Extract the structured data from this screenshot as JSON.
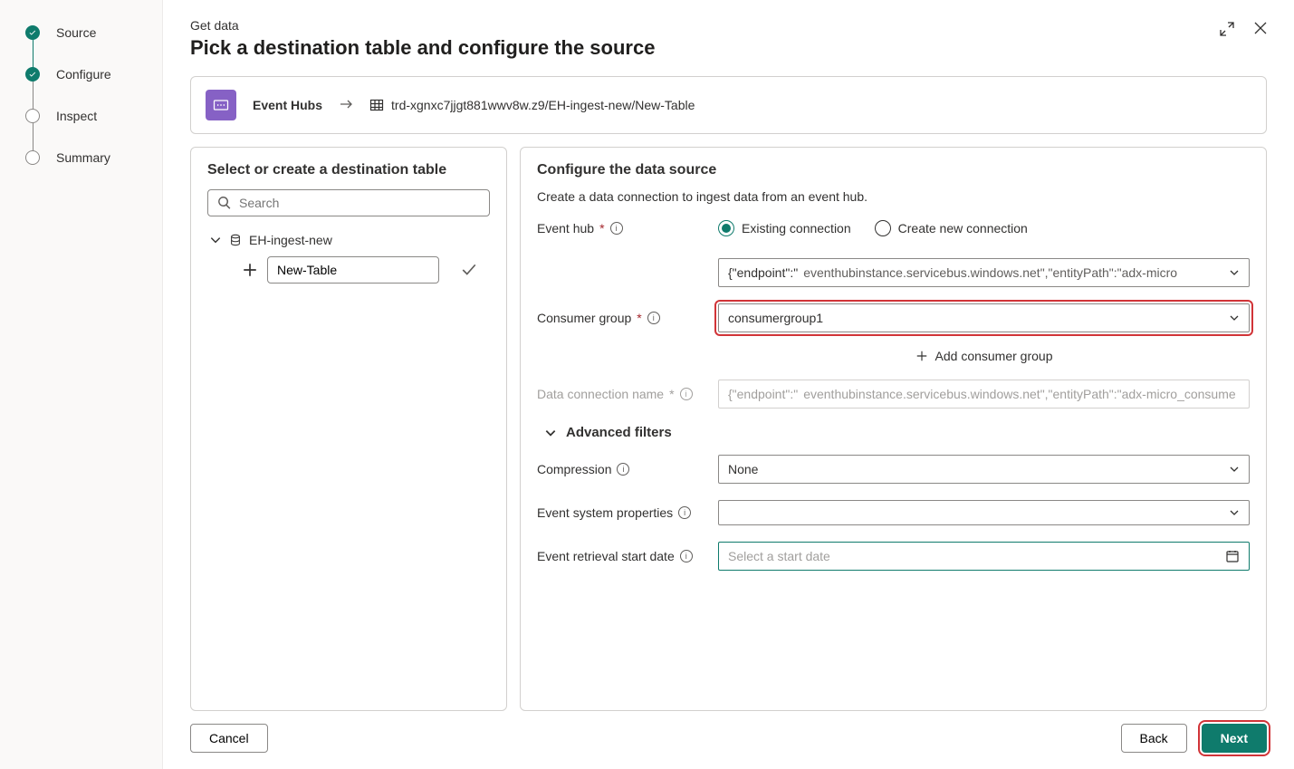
{
  "stepper": [
    {
      "label": "Source",
      "state": "done"
    },
    {
      "label": "Configure",
      "state": "done"
    },
    {
      "label": "Inspect",
      "state": "pending"
    },
    {
      "label": "Summary",
      "state": "pending"
    }
  ],
  "header": {
    "crumb": "Get data",
    "title": "Pick a destination table and configure the source"
  },
  "path": {
    "source_label": "Event Hubs",
    "destination": "trd-xgnxc7jjgt881wwv8w.z9/EH-ingest-new/New-Table"
  },
  "left_panel": {
    "title": "Select or create a destination table",
    "search_placeholder": "Search",
    "db_name": "EH-ingest-new",
    "new_table_value": "New-Table"
  },
  "right_panel": {
    "title": "Configure the data source",
    "subtitle": "Create a data connection to ingest data from an event hub.",
    "labels": {
      "event_hub": "Event hub",
      "consumer_group": "Consumer group",
      "data_connection_name": "Data connection name",
      "add_consumer": "Add consumer group",
      "advanced_filters": "Advanced filters",
      "compression": "Compression",
      "event_system_props": "Event system properties",
      "retrieval_date": "Event retrieval start date"
    },
    "radios": {
      "existing": "Existing connection",
      "create": "Create new connection"
    },
    "endpoint_prefix": "{\"endpoint\":\"",
    "endpoint_value": "eventhubinstance.servicebus.windows.net\",\"entityPath\":\"adx-micro",
    "consumer_group_value": "consumergroup1",
    "data_conn_prefix": "{\"endpoint\":\"",
    "data_conn_value": "eventhubinstance.servicebus.windows.net\",\"entityPath\":\"adx-micro_consume",
    "compression_value": "None",
    "event_props_value": "",
    "date_placeholder": "Select a start date"
  },
  "footer": {
    "cancel": "Cancel",
    "back": "Back",
    "next": "Next"
  }
}
